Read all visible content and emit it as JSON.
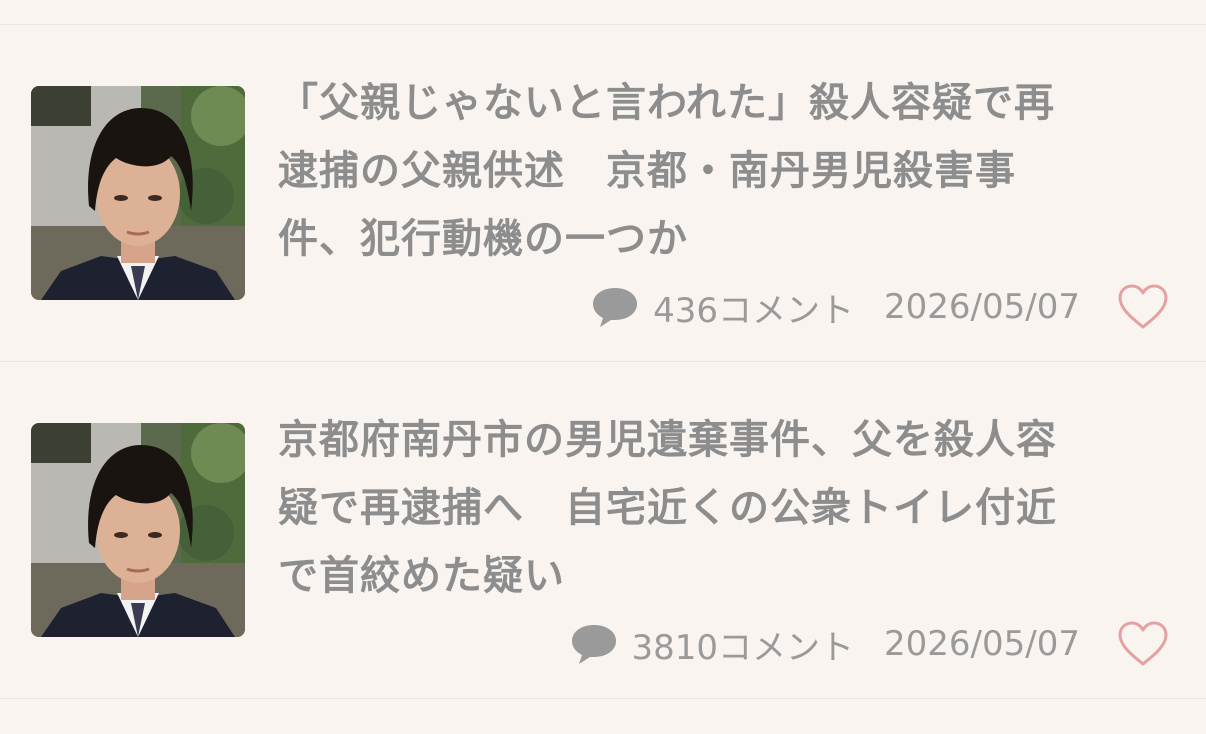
{
  "articles": [
    {
      "title_lines": [
        "「父親じゃないと言われた」殺人容疑で再",
        "逮捕の父親供述　京都・南丹男児殺害事",
        "件、犯行動機の一つか"
      ],
      "comment_count": "436",
      "comment_label": "コメント",
      "date": "2026/05/07",
      "icons": {
        "comment": "comment-bubble-icon",
        "like": "heart-outline-icon"
      }
    },
    {
      "title_lines": [
        "京都府南丹市の男児遺棄事件、父を殺人容",
        "疑で再逮捕へ　自宅近くの公衆トイレ付近",
        "で首絞めた疑い"
      ],
      "comment_count": "3810",
      "comment_label": "コメント",
      "date": "2026/05/07",
      "icons": {
        "comment": "comment-bubble-icon",
        "like": "heart-outline-icon"
      }
    }
  ],
  "colors": {
    "background": "#f9f4ef",
    "text": "#8d8d8d",
    "comment_icon": "#9a9a9a",
    "like_icon": "#e3a1a1",
    "divider": "#ebe6e1"
  }
}
